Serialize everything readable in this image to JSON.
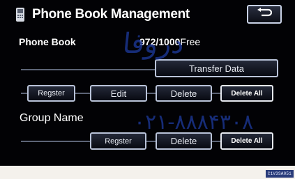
{
  "header": {
    "title": "Phone Book Management",
    "back_icon": "return-arrow-icon"
  },
  "phone_book": {
    "label": "Phone Book",
    "count": "972/1000",
    "count_suffix": "Free",
    "transfer_label": "Transfer Data",
    "register_label": "Regster",
    "edit_label": "Edit",
    "delete_label": "Delete",
    "delete_all_label": "Delete All"
  },
  "group": {
    "label": "Group Name",
    "register_label": "Regster",
    "delete_label": "Delete",
    "delete_all_label": "Delete All"
  },
  "watermark": {
    "line1": "دروفا",
    "line2": "۰۲۱-۸۸۸۴۳۰۸"
  },
  "footer": {
    "code": "C1V3SA051"
  },
  "colors": {
    "screen_background": "#020205",
    "button_border": "#b9c3d8",
    "watermark": "#1d3a9e"
  }
}
